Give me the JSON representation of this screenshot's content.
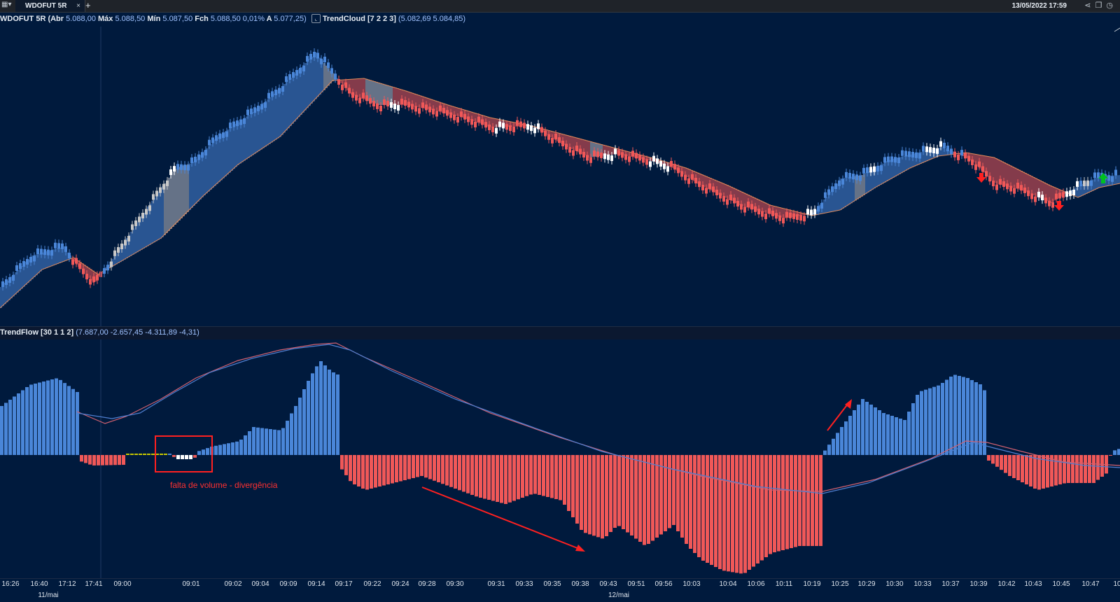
{
  "window": {
    "tab_label": "WDOFUT 5R",
    "tab_close": "×",
    "new_tab": "+",
    "datetime": "13/05/2022 17:59",
    "icons": [
      "menu-icon",
      "share-icon",
      "restore-icon",
      "clock-icon"
    ]
  },
  "price_panel": {
    "symbol": "WDOFUT 5R",
    "abr_label": "(Abr",
    "abr": "5.088,00",
    "max_label": "Máx",
    "max": "5.088,50",
    "min_label": "Mín",
    "min": "5.087,50",
    "fch_label": "Fch",
    "fch": "5.088,50",
    "pct": "0,01%",
    "a_label": "A",
    "a": "5.077,25)",
    "indicator_name": "TrendCloud [7 2 2 3]",
    "indicator_values": "(5.082,69 5.084,85)"
  },
  "oscillator_panel": {
    "title": "TrendFlow [30 1 1 2]",
    "values": "(7.687,00 -2.657,45 -4.311,89 -4,31)",
    "annotation": "falta de volume - divergência"
  },
  "colors": {
    "background": "#001a3d",
    "bull": "#4a86d8",
    "bear": "#f05858",
    "neutral": "#c8c8c8",
    "annotation": "#ff2020",
    "arrow_up": "#00c020",
    "arrow_down": "#ff2020"
  },
  "x_axis": {
    "ticks": [
      "16:26",
      "16:40",
      "17:12",
      "17:41",
      "09:00",
      "09:01",
      "09:02",
      "09:04",
      "09:09",
      "09:14",
      "09:17",
      "09:22",
      "09:24",
      "09:28",
      "09:30",
      "09:31",
      "09:33",
      "09:35",
      "09:38",
      "09:43",
      "09:51",
      "09:56",
      "10:03",
      "10:04",
      "10:06",
      "10:11",
      "10:19",
      "10:25",
      "10:29",
      "10:30",
      "10:33",
      "10:37",
      "10:39",
      "10:42",
      "10:43",
      "10:45",
      "10:47",
      "10"
    ],
    "dates": [
      "11/mai",
      "12/mai"
    ]
  }
}
